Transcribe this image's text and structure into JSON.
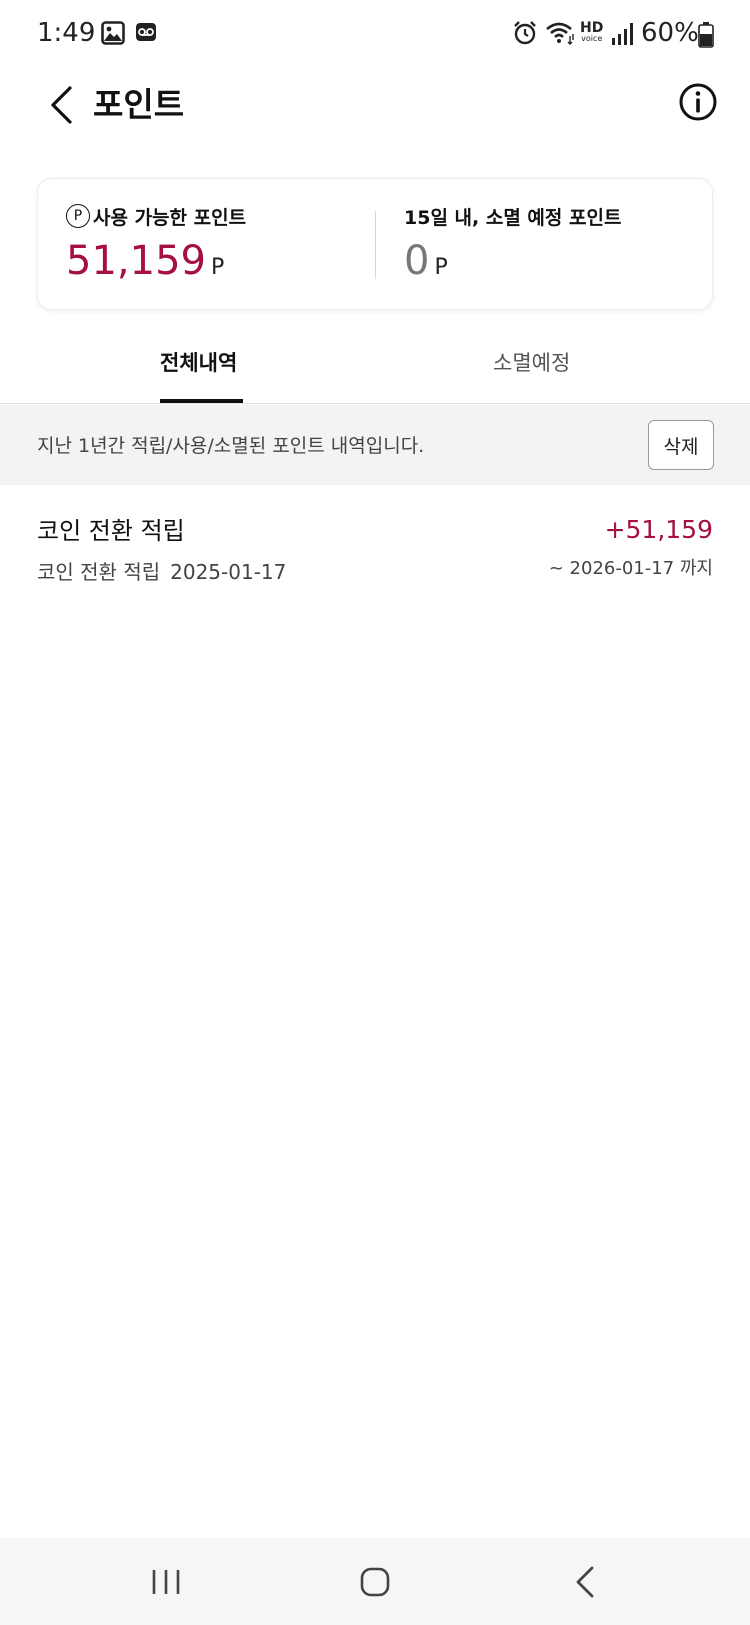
{
  "status_bar": {
    "time": "1:49",
    "battery_text": "60%",
    "hd_label": "HD",
    "hd_sub": "voice",
    "icons": [
      "gallery-icon",
      "voicemail-icon",
      "alarm-icon",
      "wifi-icon",
      "signal-icon",
      "battery-icon"
    ]
  },
  "header": {
    "title": "포인트",
    "back_icon": "chevron-left-icon",
    "info_icon": "info-icon"
  },
  "points_card": {
    "available_label": "사용 가능한 포인트",
    "available_badge": "P",
    "available_value": "51,159",
    "available_unit": "P",
    "expiring_label": "15일 내, 소멸 예정 포인트",
    "expiring_value": "0",
    "expiring_unit": "P"
  },
  "tabs": [
    {
      "label": "전체내역",
      "active": true
    },
    {
      "label": "소멸예정",
      "active": false
    }
  ],
  "notice": {
    "text": "지난 1년간 적립/사용/소멸된 포인트 내역입니다.",
    "delete_label": "삭제"
  },
  "history": [
    {
      "title": "코인 전환 적립",
      "subtitle": "코인 전환 적립",
      "date": "2025-01-17",
      "amount": "+51,159",
      "expires": "~ 2026-01-17 까지"
    }
  ],
  "nav_bar": {
    "icons": [
      "recents-icon",
      "home-icon",
      "back-icon"
    ]
  },
  "colors": {
    "accent": "#a50f45",
    "notice_bg": "#f3f3f3"
  }
}
